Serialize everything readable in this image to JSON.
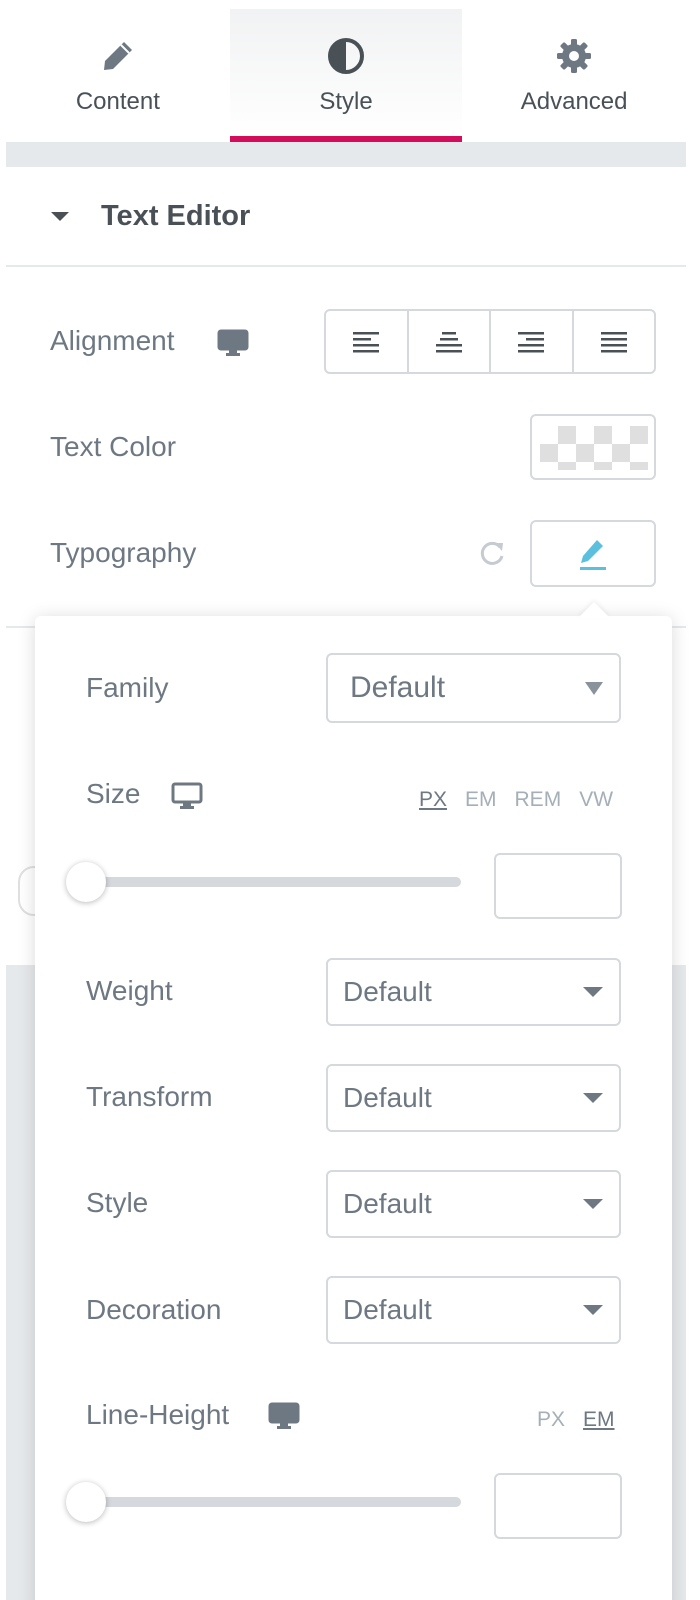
{
  "tabs": [
    {
      "label": "Content",
      "icon": "pencil-icon"
    },
    {
      "label": "Style",
      "icon": "contrast-icon",
      "active": true
    },
    {
      "label": "Advanced",
      "icon": "gear-icon"
    }
  ],
  "accent_color": "#d30c5c",
  "section": {
    "title": "Text Editor"
  },
  "controls": {
    "alignment_label": "Alignment",
    "text_color_label": "Text Color",
    "typography_label": "Typography"
  },
  "typography_popover": {
    "family": {
      "label": "Family",
      "value": "Default"
    },
    "size": {
      "label": "Size",
      "units": [
        "PX",
        "EM",
        "REM",
        "VW"
      ],
      "active_unit": "PX",
      "value": ""
    },
    "weight": {
      "label": "Weight",
      "value": "Default"
    },
    "transform": {
      "label": "Transform",
      "value": "Default"
    },
    "style": {
      "label": "Style",
      "value": "Default"
    },
    "decoration": {
      "label": "Decoration",
      "value": "Default"
    },
    "line_height": {
      "label": "Line-Height",
      "units": [
        "PX",
        "EM"
      ],
      "active_unit": "EM",
      "value": ""
    }
  }
}
